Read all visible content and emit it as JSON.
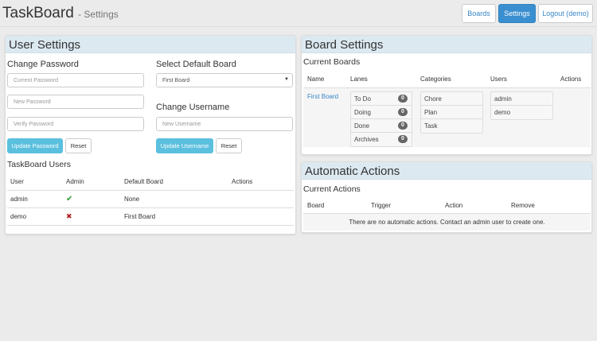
{
  "header": {
    "title": "TaskBoard",
    "subtitle": "- Settings",
    "nav": [
      "Boards",
      "Settings",
      "Logout (demo)"
    ]
  },
  "user_settings": {
    "title": "User Settings",
    "change_password": "Change Password",
    "current_password_ph": "Current Password",
    "new_password_ph": "New Password",
    "verify_password_ph": "Verify Password",
    "update_password": "Update Password",
    "reset": "Reset",
    "select_default_board": "Select Default Board",
    "default_board_value": "First Board",
    "change_username": "Change Username",
    "new_username_ph": "New Username",
    "update_username": "Update Username",
    "users_title": "TaskBoard Users",
    "columns": [
      "User",
      "Admin",
      "Default Board",
      "Actions"
    ],
    "users": [
      {
        "user": "admin",
        "admin": "✔",
        "default_board": "None"
      },
      {
        "user": "demo",
        "admin": "✖",
        "default_board": "First Board"
      }
    ]
  },
  "board_settings": {
    "title": "Board Settings",
    "current_boards": "Current Boards",
    "columns": [
      "Name",
      "Lanes",
      "Categories",
      "Users",
      "Actions"
    ],
    "boards": [
      {
        "name": "First Board",
        "lanes": [
          {
            "name": "To Do",
            "count": "0"
          },
          {
            "name": "Doing",
            "count": "0"
          },
          {
            "name": "Done",
            "count": "0"
          },
          {
            "name": "Archives",
            "count": "0"
          }
        ],
        "categories": [
          "Chore",
          "Plan",
          "Task"
        ],
        "users": [
          "admin",
          "demo"
        ]
      }
    ]
  },
  "automatic_actions": {
    "title": "Automatic Actions",
    "current_actions": "Current Actions",
    "columns": [
      "Board",
      "Trigger",
      "Action",
      "Remove"
    ],
    "empty": "There are no automatic actions. Contact an admin user to create one."
  },
  "colors": {
    "primary": "#3a8fd0",
    "info": "#5bc0de",
    "success": "#2e9a2e",
    "danger": "#b22222"
  }
}
